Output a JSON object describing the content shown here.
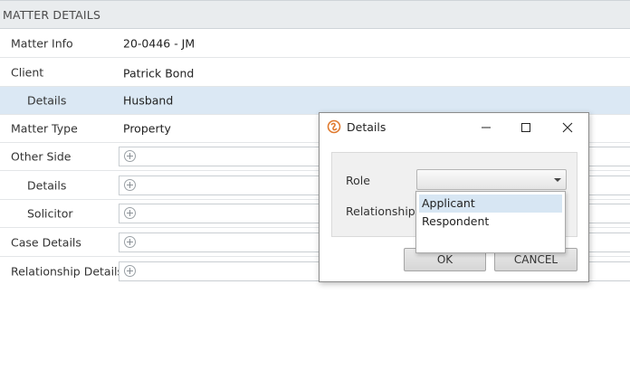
{
  "header": {
    "title": "MATTER DETAILS"
  },
  "rows": [
    {
      "label": "Matter Info",
      "value": "20-0446 - JM"
    },
    {
      "label": "Client",
      "value": "Patrick Bond"
    },
    {
      "label": "Details",
      "value": "Husband"
    },
    {
      "label": "Matter Type",
      "value": "Property"
    },
    {
      "label": "Other Side"
    },
    {
      "label": "Details"
    },
    {
      "label": "Solicitor"
    },
    {
      "label": "Case Details"
    },
    {
      "label": "Relationship Details"
    }
  ],
  "dialog": {
    "title": "Details",
    "role_label": "Role",
    "relationship_label": "Relationship",
    "role_value": "",
    "ok_label": "OK",
    "cancel_label": "CANCEL",
    "options": [
      "Applicant",
      "Respondent"
    ],
    "highlighted_option": "Applicant"
  },
  "colors": {
    "selected_row": "#dbe8f4",
    "header_bg": "#e9ecee",
    "logo_accent": "#e07a2e"
  }
}
